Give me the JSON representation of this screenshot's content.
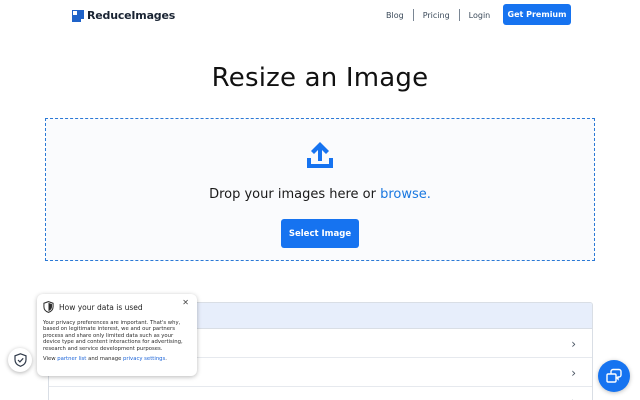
{
  "header": {
    "logo_text": "ReduceImages",
    "nav": [
      {
        "label": "Blog"
      },
      {
        "label": "Pricing"
      },
      {
        "label": "Login"
      }
    ],
    "cta_label": "Get Premium"
  },
  "main": {
    "title": "Resize an Image",
    "dropzone": {
      "text_prefix": "Drop your images here or ",
      "browse_link": "browse.",
      "select_button": "Select Image"
    }
  },
  "privacy_popover": {
    "title": "How your data is used",
    "body": "Your privacy preferences are important. That's why, based on legitimate interest, we and our partners process and share only limited data such as your device type and content interactions for advertising, research and service development purposes.",
    "foot_prefix": "View ",
    "partner_link": "partner list",
    "foot_mid": " and manage ",
    "settings_link": "privacy settings",
    "foot_suffix": "."
  },
  "icons": {
    "upload": "upload-icon",
    "shield": "shield-icon",
    "close": "close-icon",
    "chevron": "chevron-right-icon",
    "help": "help-icon"
  },
  "colors": {
    "accent": "#1673f0",
    "link": "#1a78e0",
    "dropzone_border": "#2b79d6"
  }
}
